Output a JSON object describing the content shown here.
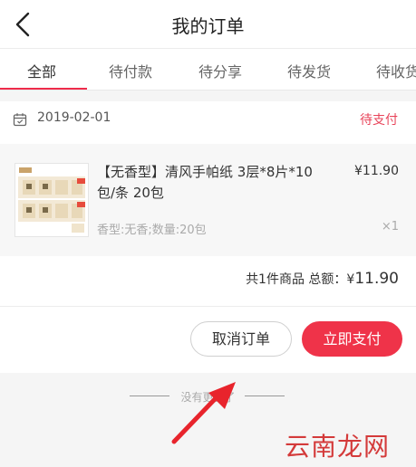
{
  "header": {
    "title": "我的订单"
  },
  "tabs": [
    {
      "label": "全部",
      "active": true
    },
    {
      "label": "待付款",
      "active": false
    },
    {
      "label": "待分享",
      "active": false
    },
    {
      "label": "待发货",
      "active": false
    },
    {
      "label": "待收货",
      "active": false
    }
  ],
  "order": {
    "date": "2019-02-01",
    "status": "待支付",
    "product": {
      "name": "【无香型】清风手帕纸 3层*8片*10包/条 20包",
      "price": "¥11.90",
      "spec": "香型:无香;数量:20包",
      "qty": "×1"
    },
    "summary": {
      "prefix": "共1件商品 总额：¥",
      "amount": "11.90"
    },
    "cancel_label": "取消订单",
    "pay_label": "立即支付"
  },
  "footer": {
    "note": "没有更多了"
  },
  "watermark": "云南龙网",
  "colors": {
    "accent": "#ef3349",
    "status": "#e8445a",
    "arrow": "#e8242c"
  }
}
